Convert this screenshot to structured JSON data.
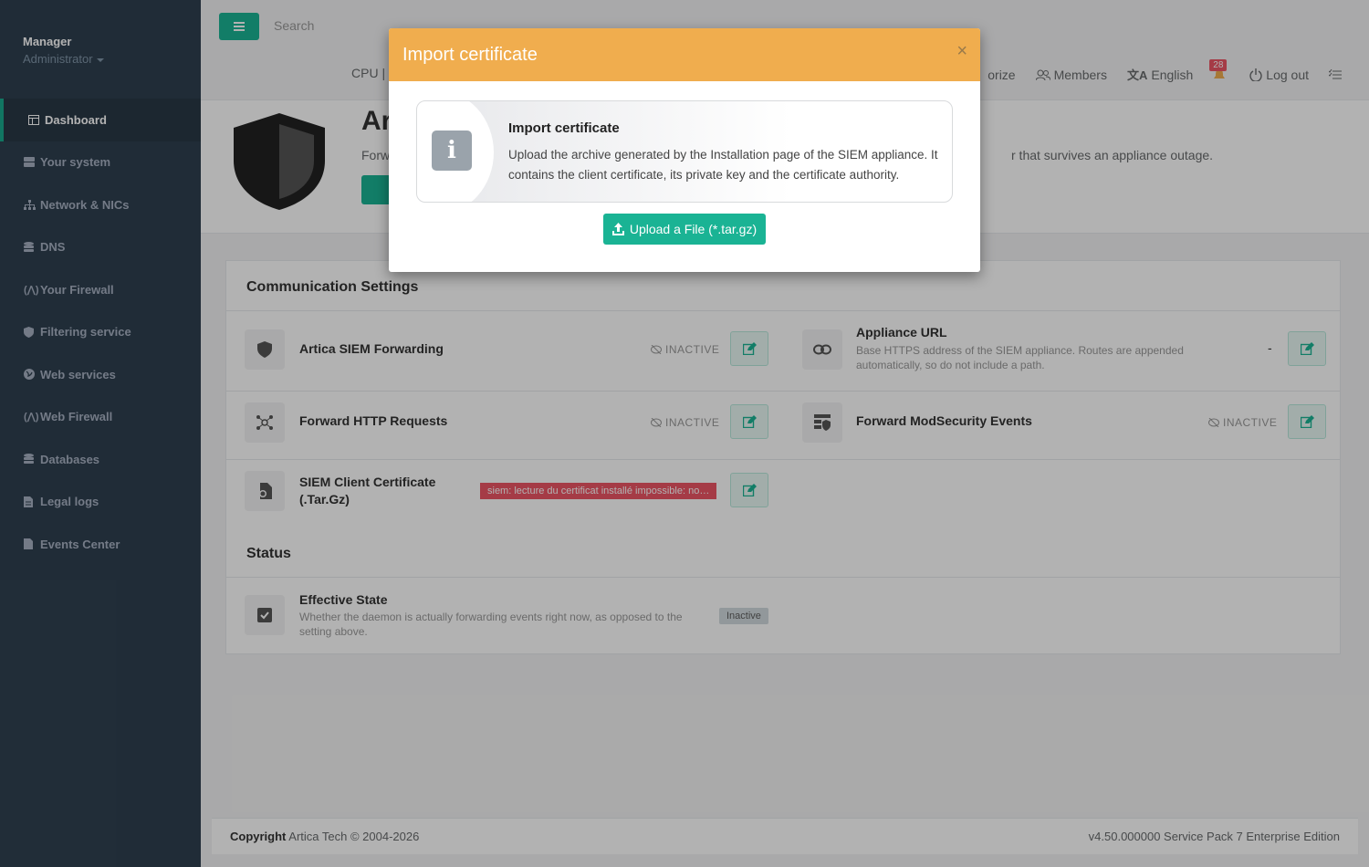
{
  "sidebar": {
    "user": "Manager",
    "role": "Administrator",
    "items": [
      {
        "label": "Dashboard",
        "icon": "dashboard-icon"
      },
      {
        "label": "Your system",
        "icon": "server-icon"
      },
      {
        "label": "Network & NICs",
        "icon": "network-icon"
      },
      {
        "label": "DNS",
        "icon": "database-icon"
      },
      {
        "label": "Your Firewall",
        "icon": "firewall-icon"
      },
      {
        "label": "Filtering service",
        "icon": "shield-icon"
      },
      {
        "label": "Web services",
        "icon": "globe-icon"
      },
      {
        "label": "Web Firewall",
        "icon": "firewall-icon"
      },
      {
        "label": "Databases",
        "icon": "database-icon"
      },
      {
        "label": "Legal logs",
        "icon": "file-icon"
      },
      {
        "label": "Events Center",
        "icon": "file-icon"
      }
    ]
  },
  "topbar": {
    "search_placeholder": "Search",
    "cpu_label": "CPU | ",
    "authorize": "orize",
    "members": "Members",
    "language": "English",
    "notifications": "28",
    "logout": "Log out"
  },
  "header": {
    "title": "Ar",
    "desc_left": "Forw",
    "desc_right": "r that survives an appliance outage."
  },
  "communication": {
    "title": "Communication Settings",
    "forwarding": {
      "label": "Artica SIEM Forwarding",
      "status": "INACTIVE"
    },
    "appliance_url": {
      "label": "Appliance URL",
      "sub": "Base HTTPS address of the SIEM appliance. Routes are appended automatically, so do not include a path.",
      "value": "-"
    },
    "http_requests": {
      "label": "Forward HTTP Requests",
      "status": "INACTIVE"
    },
    "modsecurity": {
      "label": "Forward ModSecurity Events",
      "status": "INACTIVE"
    },
    "certificate": {
      "label": "SIEM Client Certificate (.Tar.Gz)",
      "error": "siem: lecture du certificat installé impossible: no…"
    }
  },
  "status": {
    "title": "Status",
    "effective": {
      "label": "Effective State",
      "sub": "Whether the daemon is actually forwarding events right now, as opposed to the setting above.",
      "value": "Inactive"
    }
  },
  "footer": {
    "copyright_bold": "Copyright",
    "copyright_text": " Artica Tech © 2004-2026",
    "version": "v4.50.000000 Service Pack 7 Enterprise Edition"
  },
  "modal": {
    "title": "Import certificate",
    "close": "×",
    "info_title": "Import certificate",
    "info_text": "Upload the archive generated by the Installation page of the SIEM appliance. It contains the client certificate, its private key and the certificate authority.",
    "upload_label": "Upload a File (*.tar.gz)"
  },
  "colors": {
    "accent": "#1ab394",
    "modal_header": "#f0ad4e",
    "sidebar": "#2f4050",
    "danger": "#ed5565"
  }
}
